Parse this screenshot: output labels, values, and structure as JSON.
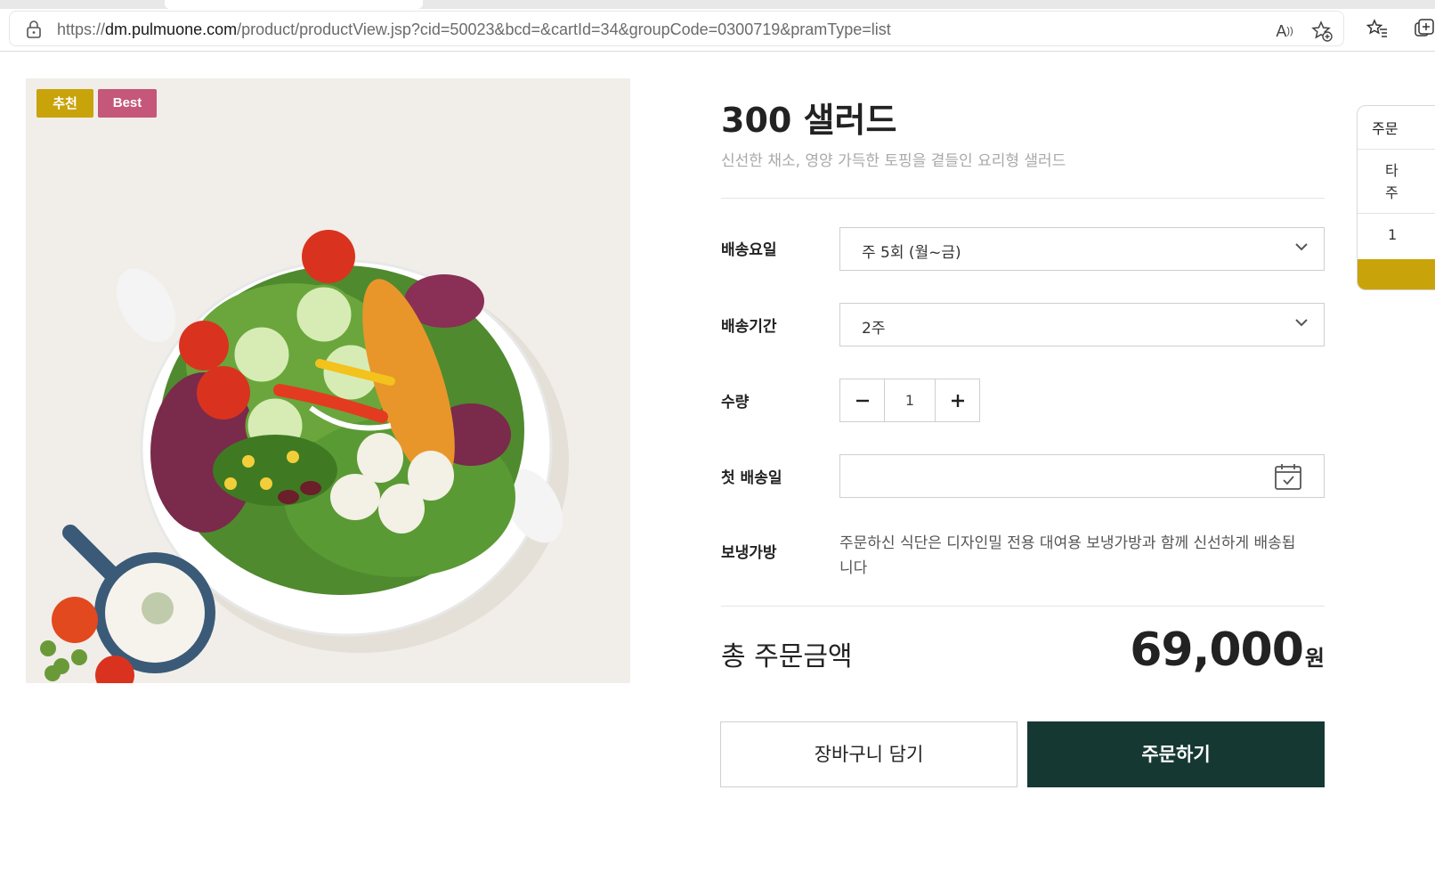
{
  "browser": {
    "url_scheme": "https://",
    "url_host": "dm.pulmuone.com",
    "url_path": "/product/productView.jsp?cid=50023&bcd=&cartId=34&groupCode=0300719&pramType=list",
    "read_aloud_glyph": "A",
    "icons": [
      "lock-icon",
      "read-aloud-icon",
      "add-favorite-icon",
      "favorites-icon",
      "collections-icon"
    ]
  },
  "product": {
    "badges": [
      "추천",
      "Best"
    ],
    "badge_colors": [
      "#c9a30a",
      "#c4577a"
    ],
    "title": "300 샐러드",
    "subtitle": "신선한 채소, 영양 가득한 토핑을 곁들인 요리형 샐러드",
    "image_alt": "salad bowl"
  },
  "options": {
    "delivery_days_label": "배송요일",
    "delivery_days_value": "주 5회 (월~금)",
    "delivery_period_label": "배송기간",
    "delivery_period_value": "2주",
    "quantity_label": "수량",
    "quantity_value": "1",
    "first_delivery_label": "첫 배송일",
    "cooler_label": "보냉가방",
    "cooler_text": "주문하신 식단은 디자인밀 전용 대여용 보냉가방과 함께 신선하게 배송됩니다"
  },
  "total": {
    "label": "총 주문금액",
    "amount": "69,000",
    "unit": "원"
  },
  "actions": {
    "cart_label": "장바구니 담기",
    "order_label": "주문하기",
    "order_color": "#163833"
  },
  "side_panel": {
    "title": "주문",
    "line1": "타",
    "line2": "주",
    "qty": "1",
    "accent": "#c9a30a"
  }
}
